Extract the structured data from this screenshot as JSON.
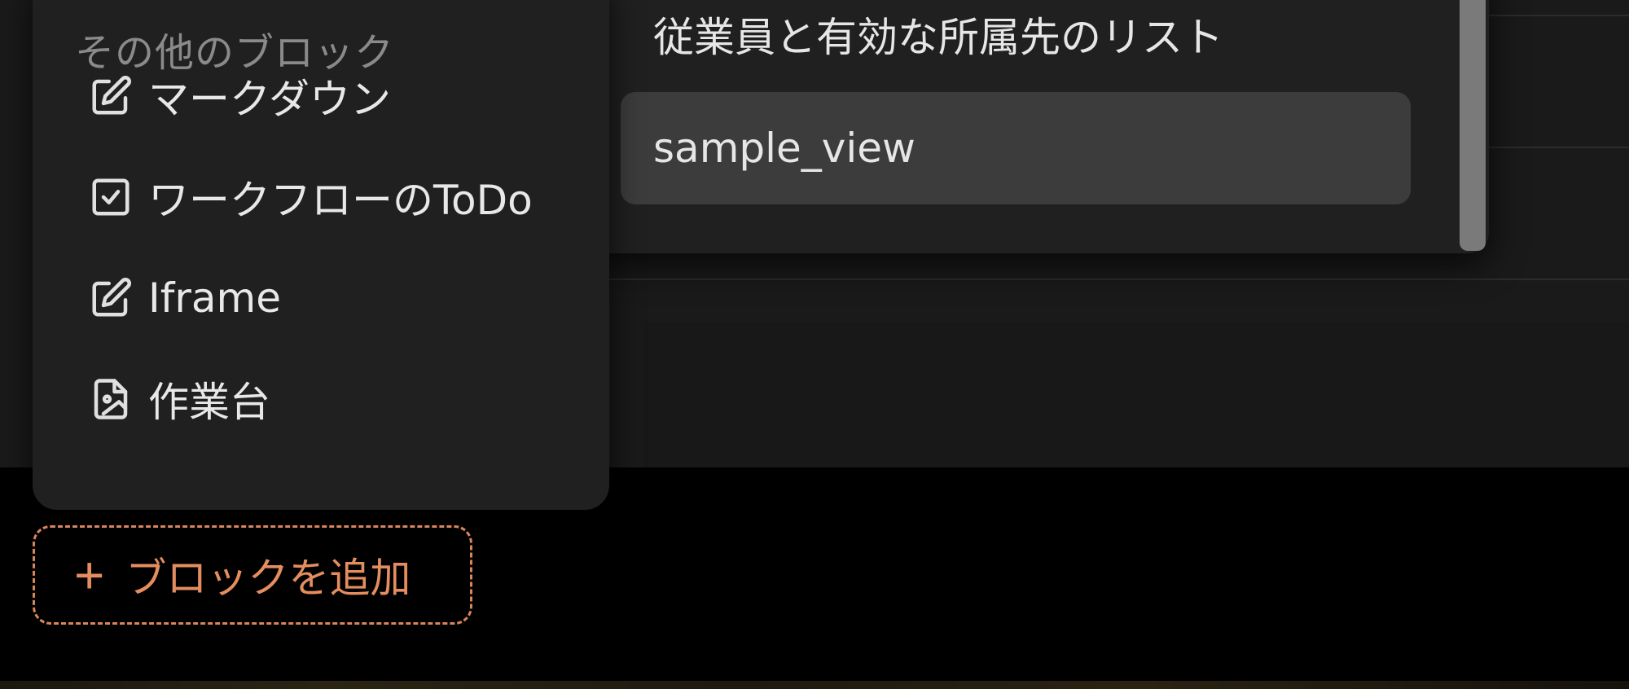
{
  "block_menu": {
    "section_label": "その他のブロック",
    "items": [
      {
        "label": "マークダウン",
        "icon": "edit-icon"
      },
      {
        "label": "ワークフローのToDo",
        "icon": "checkbox-icon"
      },
      {
        "label": "Iframe",
        "icon": "edit-icon"
      },
      {
        "label": "作業台",
        "icon": "file-image-icon"
      }
    ]
  },
  "view_dropdown": {
    "items": [
      {
        "label": "従業員と有効な所属先のリスト",
        "highlighted": false
      },
      {
        "label": "sample_view",
        "highlighted": true
      }
    ]
  },
  "add_block": {
    "icon": "plus-icon",
    "label": "ブロックを追加"
  },
  "colors": {
    "accent": "#e48d5f",
    "menu_bg": "#202020",
    "highlight_bg": "#3c3c3c",
    "page_bg": "#000000"
  }
}
